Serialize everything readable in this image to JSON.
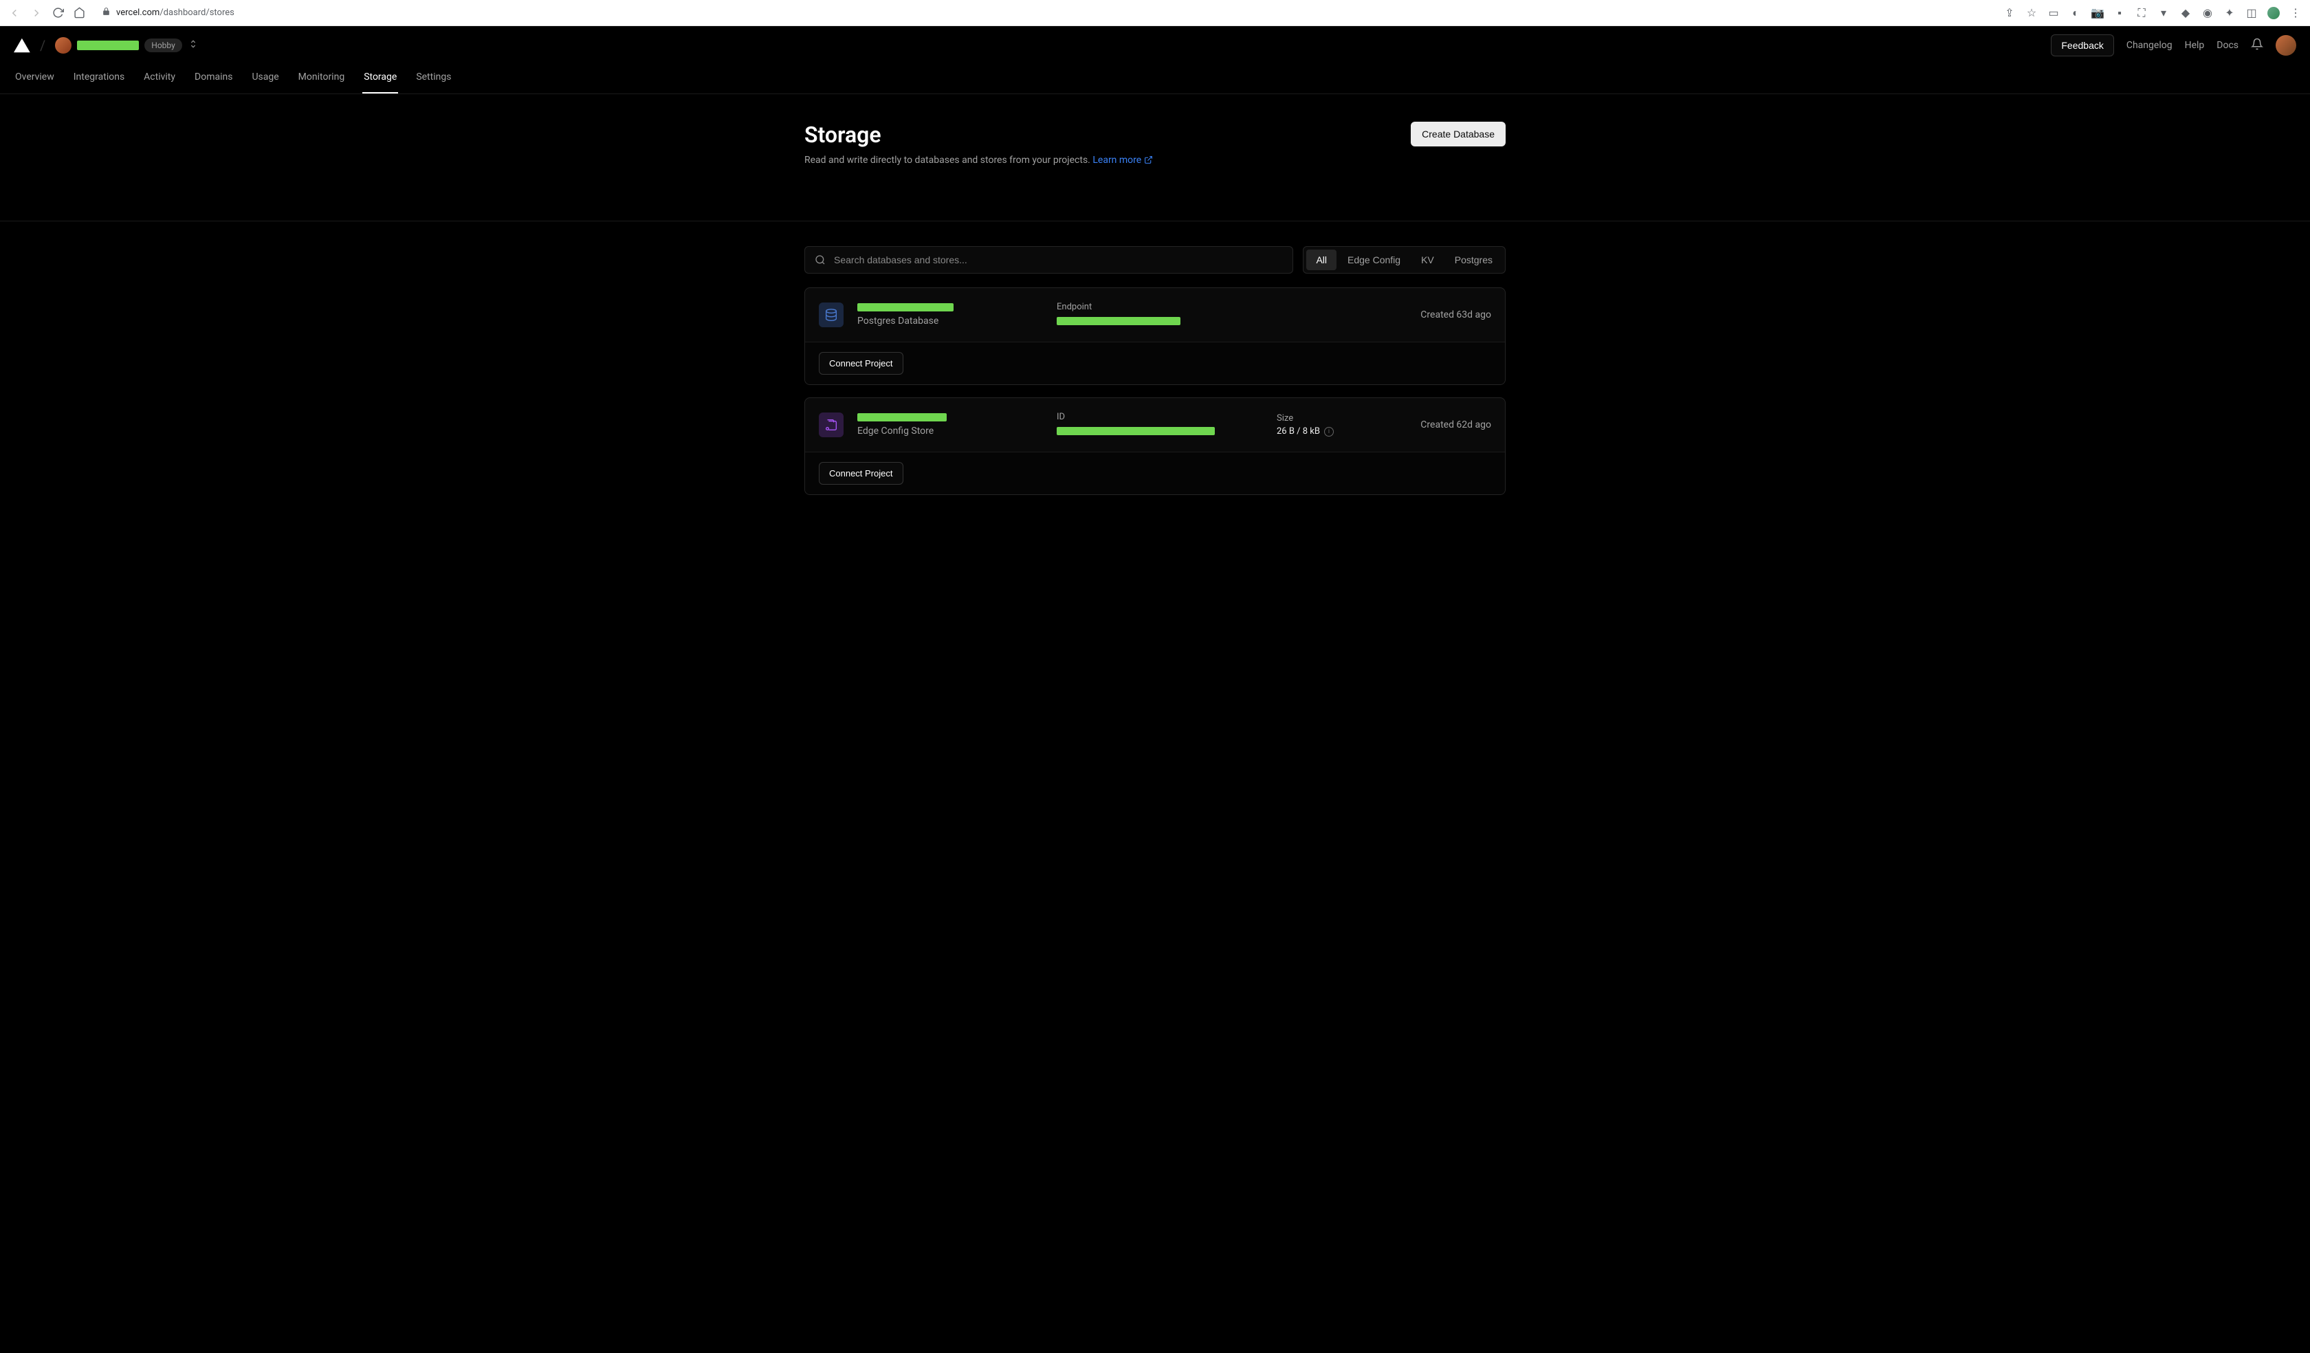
{
  "browser": {
    "url_domain": "vercel.com",
    "url_path": "/dashboard/stores"
  },
  "header": {
    "plan": "Hobby",
    "feedback": "Feedback",
    "links": [
      "Changelog",
      "Help",
      "Docs"
    ]
  },
  "tabs": [
    "Overview",
    "Integrations",
    "Activity",
    "Domains",
    "Usage",
    "Monitoring",
    "Storage",
    "Settings"
  ],
  "active_tab": "Storage",
  "page": {
    "title": "Storage",
    "description": "Read and write directly to databases and stores from your projects. ",
    "learn_more": "Learn more",
    "create_button": "Create Database"
  },
  "search": {
    "placeholder": "Search databases and stores..."
  },
  "filters": [
    "All",
    "Edge Config",
    "KV",
    "Postgres"
  ],
  "active_filter": "All",
  "stores": [
    {
      "type": "Postgres Database",
      "icon": "postgres",
      "endpoint_label": "Endpoint",
      "created": "Created 63d ago",
      "connect": "Connect Project"
    },
    {
      "type": "Edge Config Store",
      "icon": "edgeconfig",
      "id_label": "ID",
      "size_label": "Size",
      "size_value": "26 B / 8 kB",
      "created": "Created 62d ago",
      "connect": "Connect Project"
    }
  ]
}
